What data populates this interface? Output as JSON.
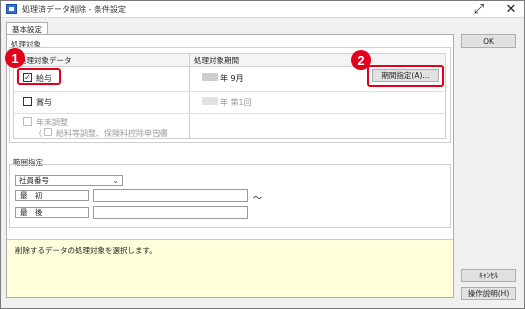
{
  "window": {
    "title": "処理済データ削除 - 条件設定",
    "expand_glyph": "⤢",
    "close_glyph": "✕"
  },
  "tab": {
    "label": "基本設定"
  },
  "target_group": {
    "title": "処理対象",
    "col_target": "処理対象データ",
    "col_period": "処理対象期間",
    "rows": [
      {
        "label": "給与",
        "checked": true,
        "period_text": "年 9月"
      },
      {
        "label": "賞与",
        "checked": false,
        "period_text": "年 第1回"
      },
      {
        "label": "年末調整",
        "sub_label": "給料等調整、保険料控除申告書",
        "disabled": true
      }
    ],
    "check_mark": "✓",
    "open_paren": "（",
    "close_paren": "）"
  },
  "period_button": {
    "label": "期間指定(A)..."
  },
  "range_group": {
    "title": "範囲指定",
    "select_value": "社員番号",
    "chevron": "⌄",
    "first_label": "最　初",
    "last_label": "最　後",
    "tilde": "～"
  },
  "message": "削除するデータの処理対象を選択します。",
  "buttons": {
    "ok": "OK",
    "cancel": "ｷｬﾝｾﾙ",
    "help": "操作説明(H)"
  },
  "callouts": [
    "1",
    "2"
  ],
  "colors": {
    "highlight": "#e3001b",
    "message_bg": "#ffffdc",
    "panel_bg": "#f0f0f0"
  }
}
